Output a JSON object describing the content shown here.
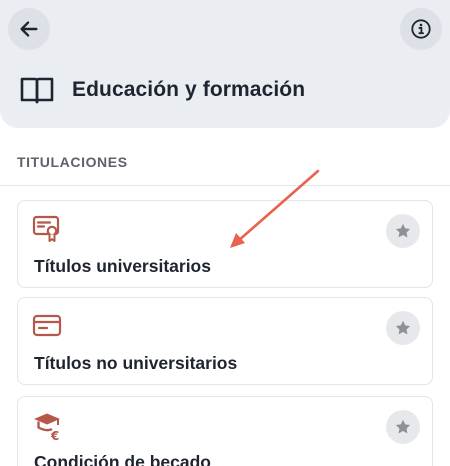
{
  "header": {
    "title": "Educación y formación",
    "back_icon": "arrow-left-icon",
    "info_icon": "info-icon",
    "section_icon": "book-open-icon"
  },
  "section": {
    "label": "TITULACIONES"
  },
  "cards": [
    {
      "label": "Títulos universitarios",
      "icon": "certificate-icon",
      "favorite": false
    },
    {
      "label": "Títulos no universitarios",
      "icon": "card-icon",
      "favorite": false
    },
    {
      "label": "Condición de becado",
      "icon": "graduation-cap-euro-icon",
      "favorite": false
    }
  ],
  "colors": {
    "header_bg": "#eaeef3",
    "accent_icon": "#b5584a",
    "annotation_arrow": "#e8624f",
    "star": "#8d9096"
  }
}
